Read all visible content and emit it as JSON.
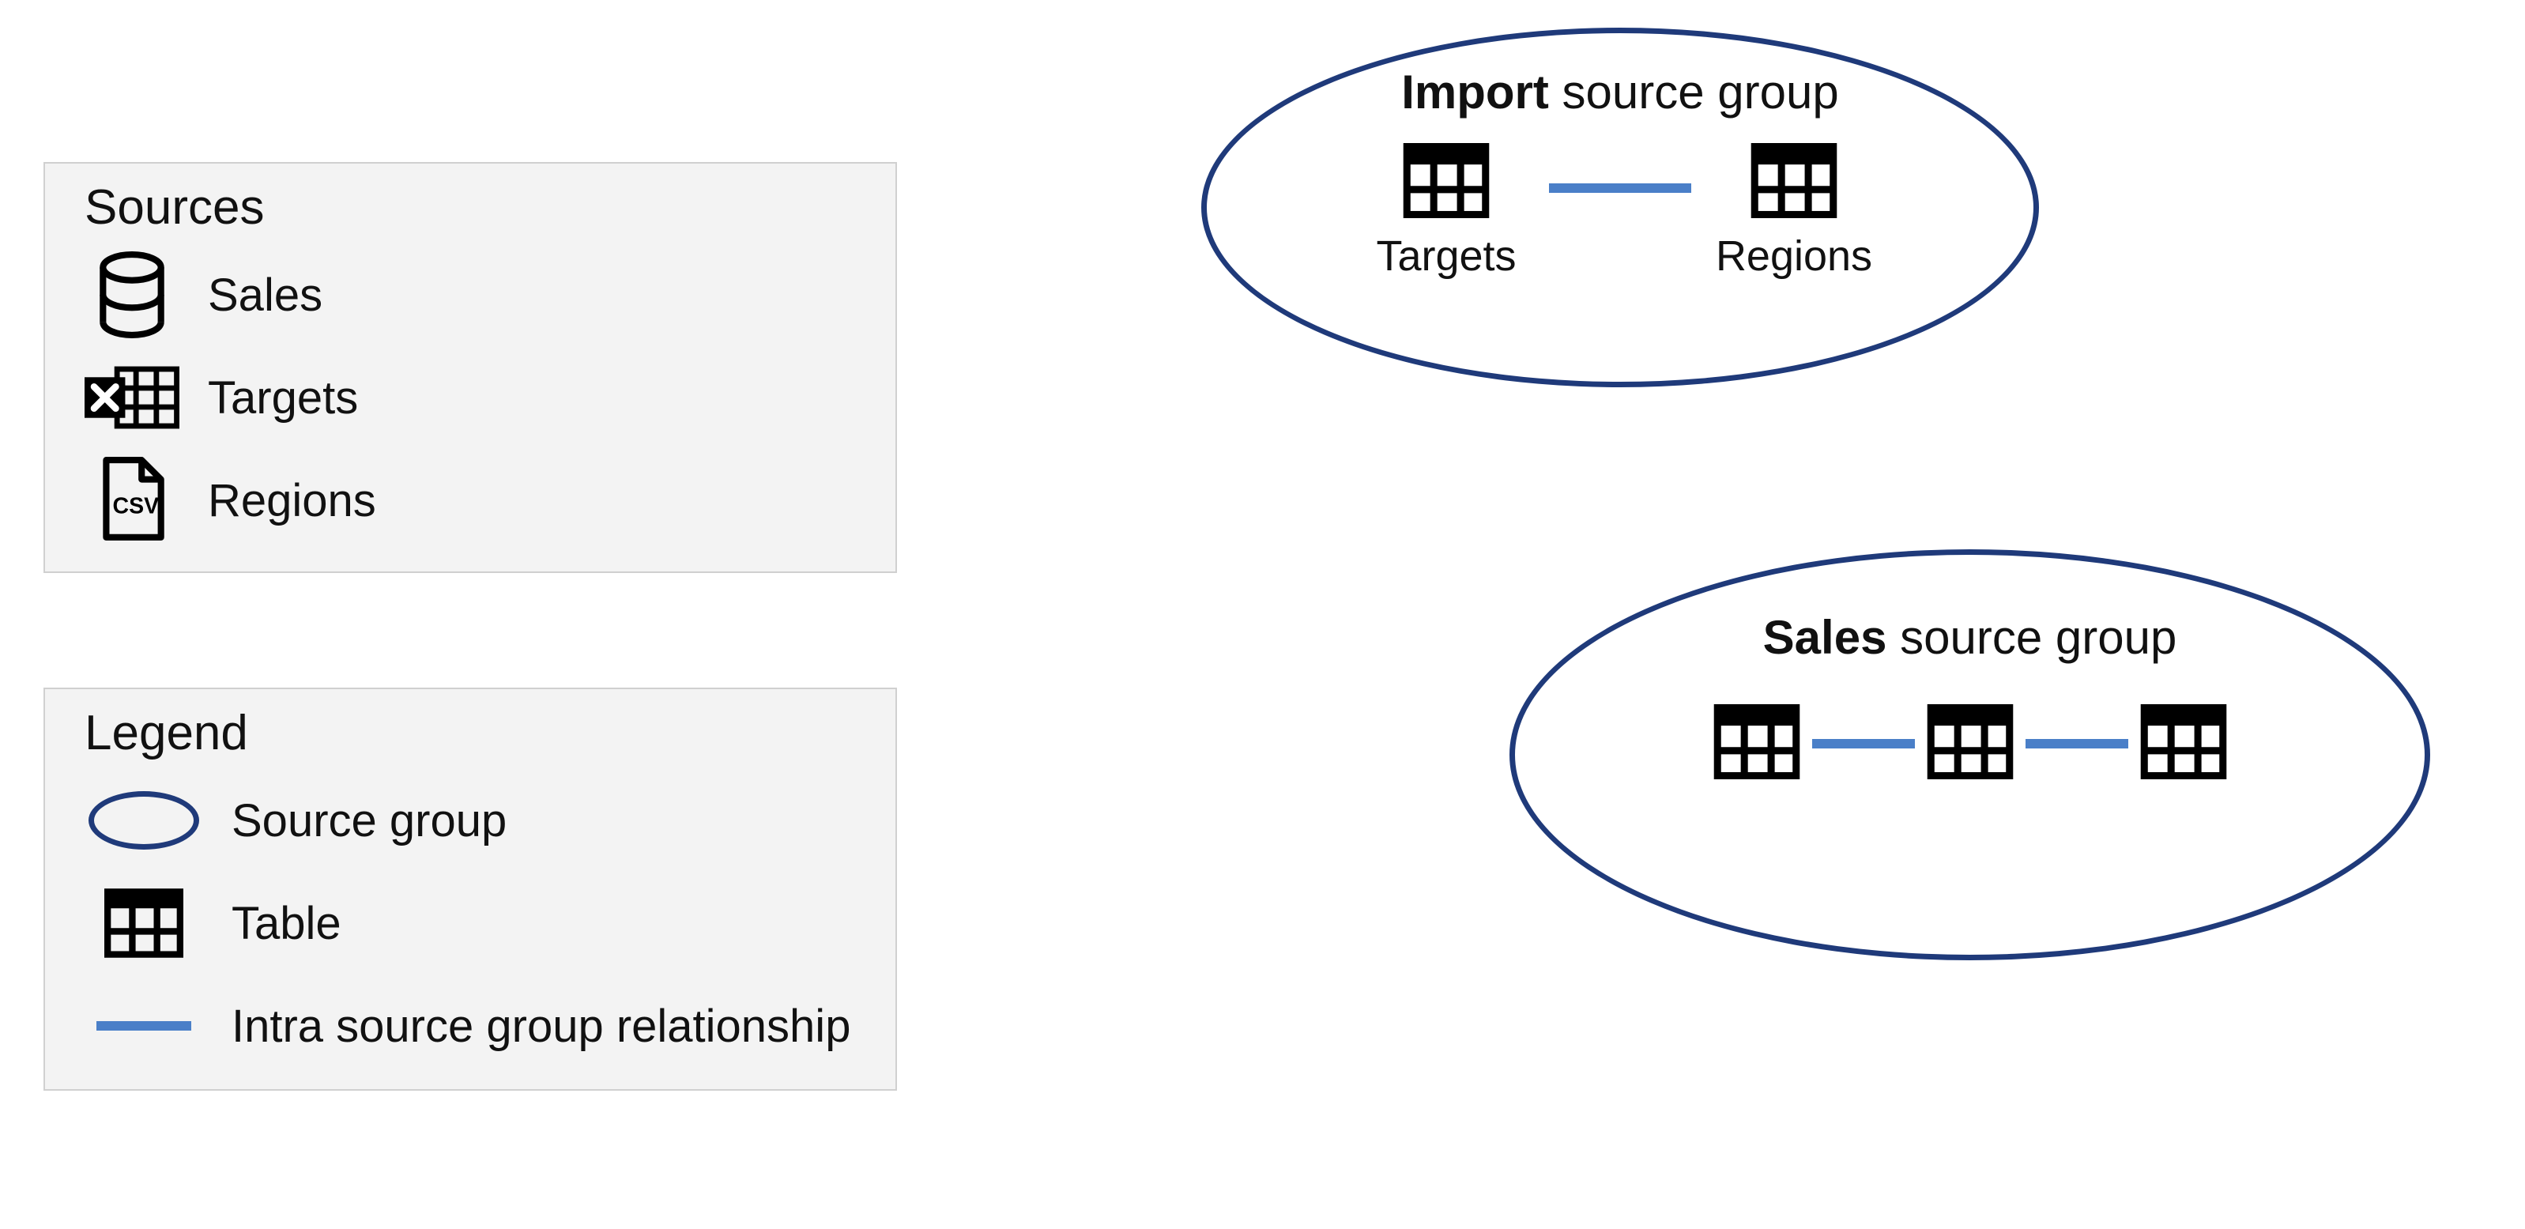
{
  "sources": {
    "title": "Sources",
    "items": [
      {
        "icon": "database",
        "label": "Sales"
      },
      {
        "icon": "excel",
        "label": "Targets"
      },
      {
        "icon": "csv",
        "label": "Regions"
      }
    ]
  },
  "legend": {
    "title": "Legend",
    "items": [
      {
        "icon": "ellipse",
        "label": "Source group"
      },
      {
        "icon": "table",
        "label": "Table"
      },
      {
        "icon": "line",
        "label": "Intra source group relationship"
      }
    ]
  },
  "groups": {
    "import": {
      "title_bold": "Import",
      "title_rest": " source group",
      "tables": [
        {
          "label": "Targets"
        },
        {
          "label": "Regions"
        }
      ]
    },
    "sales": {
      "title_bold": "Sales",
      "title_rest": " source group",
      "table_count": 3
    }
  },
  "colors": {
    "ellipse_border": "#1f3a7a",
    "relationship_line": "#4a7fc8",
    "panel_bg": "#f3f3f3",
    "panel_border": "#d0d0d0"
  }
}
